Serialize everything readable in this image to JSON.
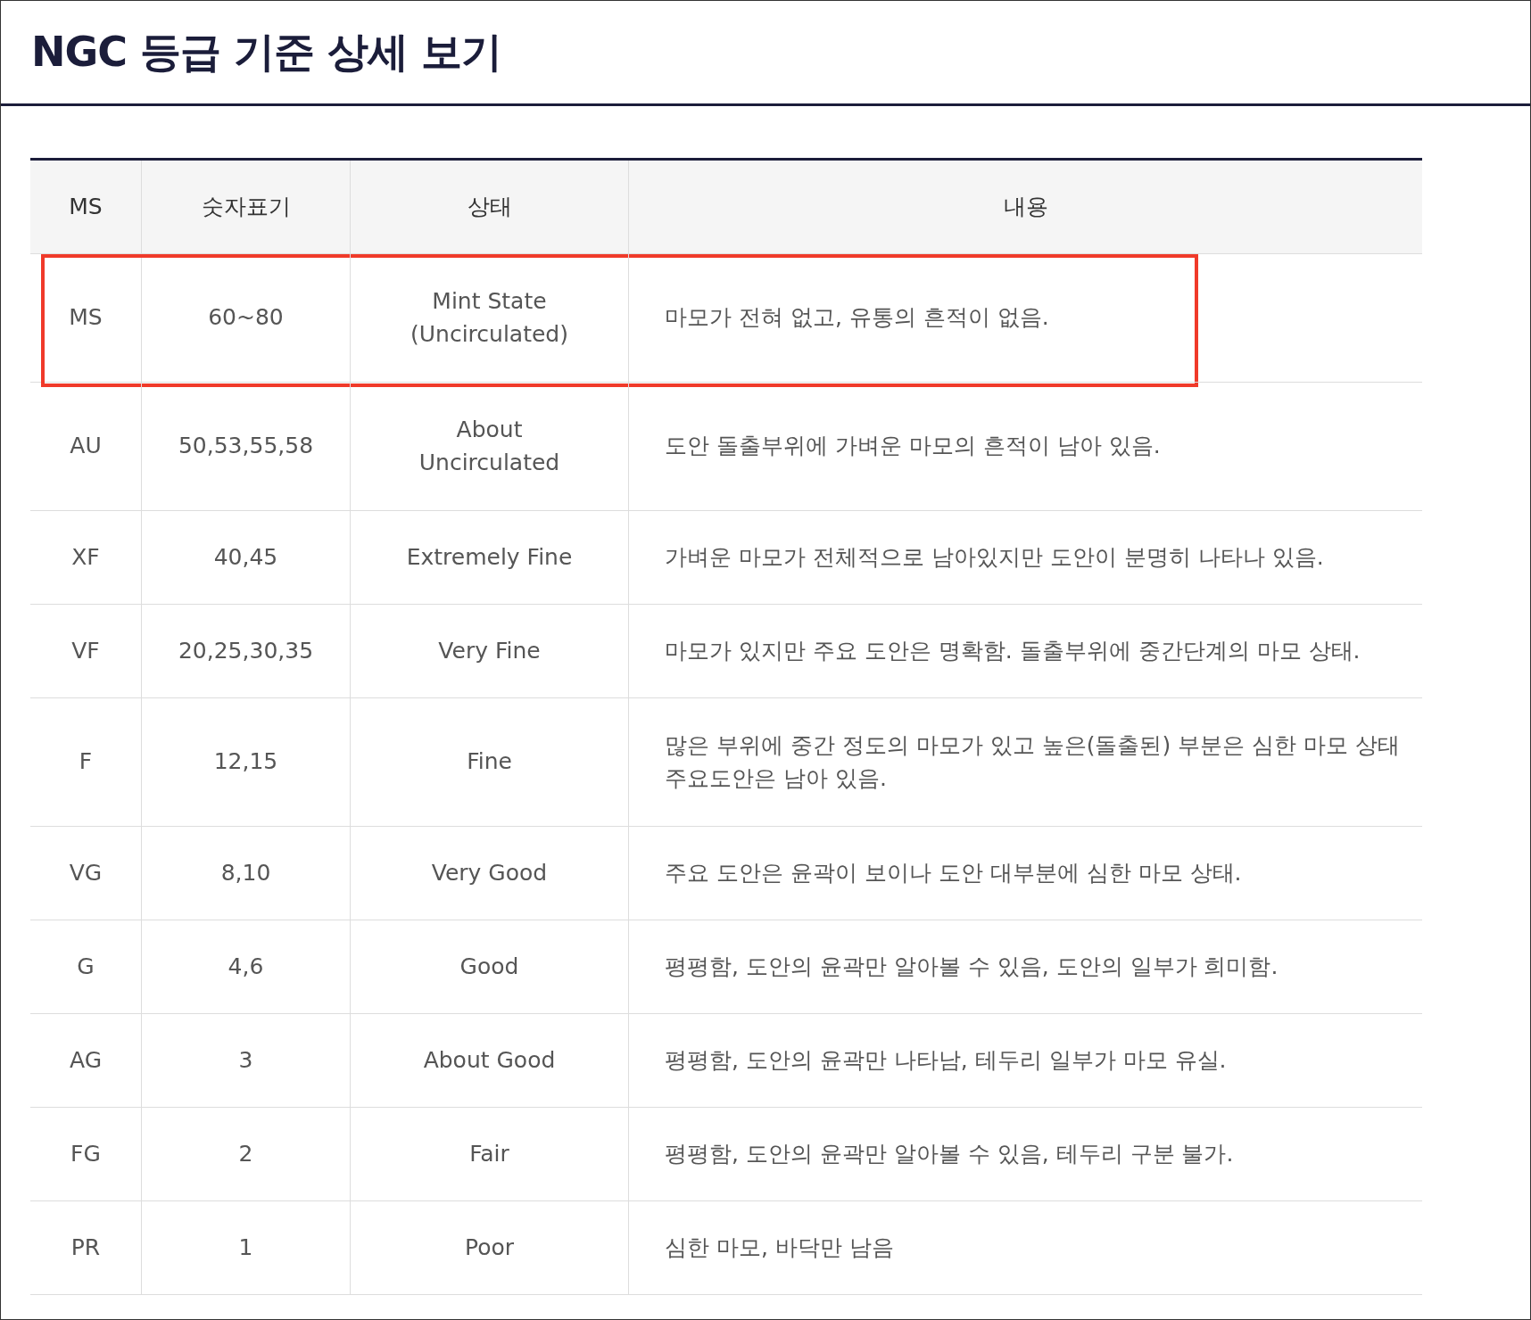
{
  "title": "NGC 등급 기준 상세 보기",
  "table": {
    "columns": [
      "MS",
      "숫자표기",
      "상태",
      "내용"
    ],
    "rows": [
      {
        "cells": [
          "MS",
          "60~80",
          "Mint State\n(Uncirculated)",
          "마모가 전혀 없고, 유통의 흔적이 없음."
        ],
        "highlighted": true
      },
      {
        "cells": [
          "AU",
          "50,53,55,58",
          "About\nUncirculated",
          "도안 돌출부위에 가벼운 마모의 흔적이 남아 있음."
        ],
        "highlighted": false
      },
      {
        "cells": [
          "XF",
          "40,45",
          "Extremely Fine",
          "가벼운 마모가 전체적으로 남아있지만 도안이 분명히 나타나 있음."
        ],
        "highlighted": false
      },
      {
        "cells": [
          "VF",
          "20,25,30,35",
          "Very Fine",
          "마모가 있지만 주요 도안은 명확함. 돌출부위에 중간단계의 마모 상태."
        ],
        "highlighted": false
      },
      {
        "cells": [
          "F",
          "12,15",
          "Fine",
          "많은 부위에 중간 정도의 마모가 있고 높은(돌출된) 부분은 심한 마모 상태\n주요도안은 남아 있음."
        ],
        "highlighted": false
      },
      {
        "cells": [
          "VG",
          "8,10",
          "Very Good",
          "주요 도안은 윤곽이 보이나 도안 대부분에 심한 마모 상태."
        ],
        "highlighted": false
      },
      {
        "cells": [
          "G",
          "4,6",
          "Good",
          "평평함, 도안의 윤곽만 알아볼 수 있음, 도안의 일부가 희미함."
        ],
        "highlighted": false
      },
      {
        "cells": [
          "AG",
          "3",
          "About Good",
          "평평함, 도안의 윤곽만 나타남, 테두리 일부가 마모 유실."
        ],
        "highlighted": false
      },
      {
        "cells": [
          "FG",
          "2",
          "Fair",
          "평평함, 도안의 윤곽만 알아볼 수 있음, 테두리 구분 불가."
        ],
        "highlighted": false
      },
      {
        "cells": [
          "PR",
          "1",
          "Poor",
          "심한 마모, 바닥만 남음"
        ],
        "highlighted": false
      }
    ]
  }
}
